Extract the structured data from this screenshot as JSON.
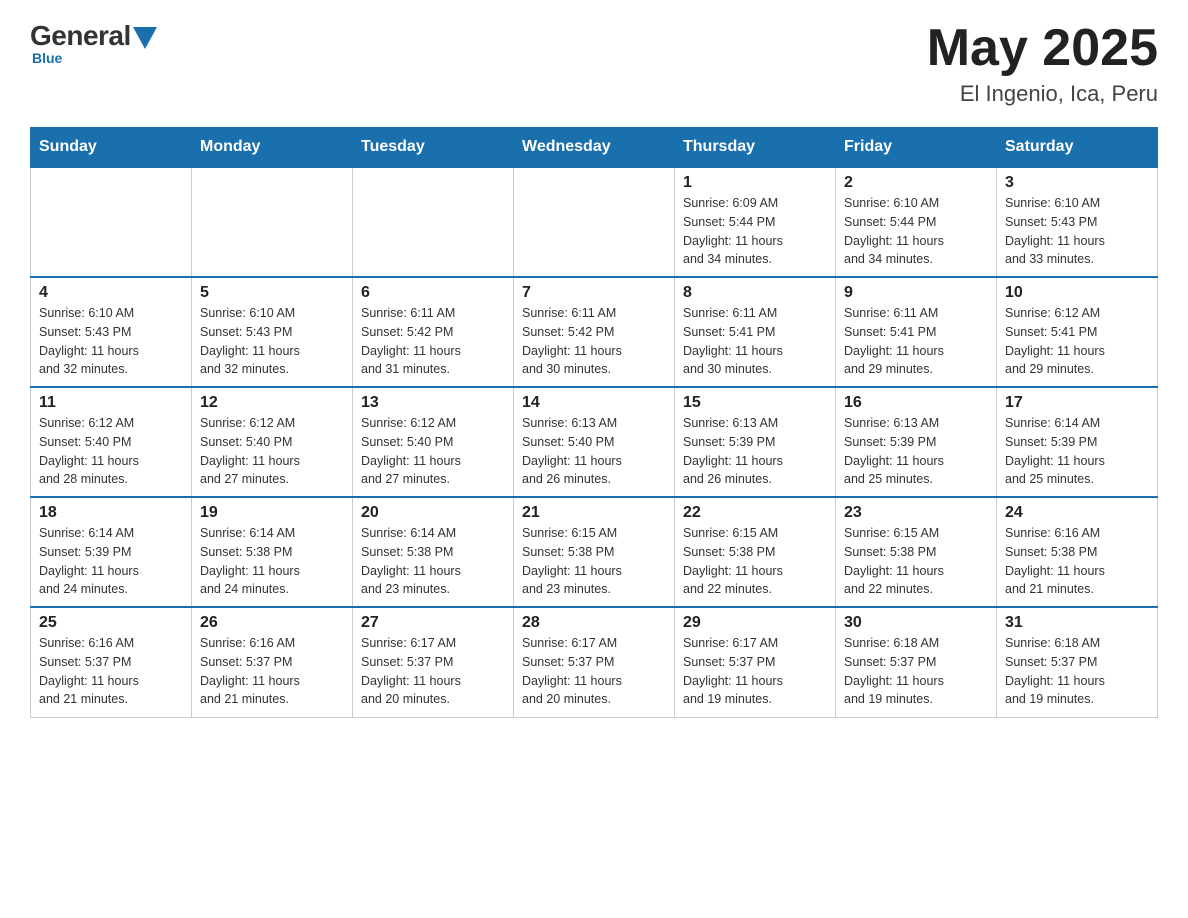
{
  "header": {
    "logo": {
      "general": "General",
      "blue": "Blue",
      "tagline": "Blue"
    },
    "title": "May 2025",
    "location": "El Ingenio, Ica, Peru"
  },
  "calendar": {
    "days_of_week": [
      "Sunday",
      "Monday",
      "Tuesday",
      "Wednesday",
      "Thursday",
      "Friday",
      "Saturday"
    ],
    "weeks": [
      [
        {
          "day": "",
          "info": ""
        },
        {
          "day": "",
          "info": ""
        },
        {
          "day": "",
          "info": ""
        },
        {
          "day": "",
          "info": ""
        },
        {
          "day": "1",
          "info": "Sunrise: 6:09 AM\nSunset: 5:44 PM\nDaylight: 11 hours\nand 34 minutes."
        },
        {
          "day": "2",
          "info": "Sunrise: 6:10 AM\nSunset: 5:44 PM\nDaylight: 11 hours\nand 34 minutes."
        },
        {
          "day": "3",
          "info": "Sunrise: 6:10 AM\nSunset: 5:43 PM\nDaylight: 11 hours\nand 33 minutes."
        }
      ],
      [
        {
          "day": "4",
          "info": "Sunrise: 6:10 AM\nSunset: 5:43 PM\nDaylight: 11 hours\nand 32 minutes."
        },
        {
          "day": "5",
          "info": "Sunrise: 6:10 AM\nSunset: 5:43 PM\nDaylight: 11 hours\nand 32 minutes."
        },
        {
          "day": "6",
          "info": "Sunrise: 6:11 AM\nSunset: 5:42 PM\nDaylight: 11 hours\nand 31 minutes."
        },
        {
          "day": "7",
          "info": "Sunrise: 6:11 AM\nSunset: 5:42 PM\nDaylight: 11 hours\nand 30 minutes."
        },
        {
          "day": "8",
          "info": "Sunrise: 6:11 AM\nSunset: 5:41 PM\nDaylight: 11 hours\nand 30 minutes."
        },
        {
          "day": "9",
          "info": "Sunrise: 6:11 AM\nSunset: 5:41 PM\nDaylight: 11 hours\nand 29 minutes."
        },
        {
          "day": "10",
          "info": "Sunrise: 6:12 AM\nSunset: 5:41 PM\nDaylight: 11 hours\nand 29 minutes."
        }
      ],
      [
        {
          "day": "11",
          "info": "Sunrise: 6:12 AM\nSunset: 5:40 PM\nDaylight: 11 hours\nand 28 minutes."
        },
        {
          "day": "12",
          "info": "Sunrise: 6:12 AM\nSunset: 5:40 PM\nDaylight: 11 hours\nand 27 minutes."
        },
        {
          "day": "13",
          "info": "Sunrise: 6:12 AM\nSunset: 5:40 PM\nDaylight: 11 hours\nand 27 minutes."
        },
        {
          "day": "14",
          "info": "Sunrise: 6:13 AM\nSunset: 5:40 PM\nDaylight: 11 hours\nand 26 minutes."
        },
        {
          "day": "15",
          "info": "Sunrise: 6:13 AM\nSunset: 5:39 PM\nDaylight: 11 hours\nand 26 minutes."
        },
        {
          "day": "16",
          "info": "Sunrise: 6:13 AM\nSunset: 5:39 PM\nDaylight: 11 hours\nand 25 minutes."
        },
        {
          "day": "17",
          "info": "Sunrise: 6:14 AM\nSunset: 5:39 PM\nDaylight: 11 hours\nand 25 minutes."
        }
      ],
      [
        {
          "day": "18",
          "info": "Sunrise: 6:14 AM\nSunset: 5:39 PM\nDaylight: 11 hours\nand 24 minutes."
        },
        {
          "day": "19",
          "info": "Sunrise: 6:14 AM\nSunset: 5:38 PM\nDaylight: 11 hours\nand 24 minutes."
        },
        {
          "day": "20",
          "info": "Sunrise: 6:14 AM\nSunset: 5:38 PM\nDaylight: 11 hours\nand 23 minutes."
        },
        {
          "day": "21",
          "info": "Sunrise: 6:15 AM\nSunset: 5:38 PM\nDaylight: 11 hours\nand 23 minutes."
        },
        {
          "day": "22",
          "info": "Sunrise: 6:15 AM\nSunset: 5:38 PM\nDaylight: 11 hours\nand 22 minutes."
        },
        {
          "day": "23",
          "info": "Sunrise: 6:15 AM\nSunset: 5:38 PM\nDaylight: 11 hours\nand 22 minutes."
        },
        {
          "day": "24",
          "info": "Sunrise: 6:16 AM\nSunset: 5:38 PM\nDaylight: 11 hours\nand 21 minutes."
        }
      ],
      [
        {
          "day": "25",
          "info": "Sunrise: 6:16 AM\nSunset: 5:37 PM\nDaylight: 11 hours\nand 21 minutes."
        },
        {
          "day": "26",
          "info": "Sunrise: 6:16 AM\nSunset: 5:37 PM\nDaylight: 11 hours\nand 21 minutes."
        },
        {
          "day": "27",
          "info": "Sunrise: 6:17 AM\nSunset: 5:37 PM\nDaylight: 11 hours\nand 20 minutes."
        },
        {
          "day": "28",
          "info": "Sunrise: 6:17 AM\nSunset: 5:37 PM\nDaylight: 11 hours\nand 20 minutes."
        },
        {
          "day": "29",
          "info": "Sunrise: 6:17 AM\nSunset: 5:37 PM\nDaylight: 11 hours\nand 19 minutes."
        },
        {
          "day": "30",
          "info": "Sunrise: 6:18 AM\nSunset: 5:37 PM\nDaylight: 11 hours\nand 19 minutes."
        },
        {
          "day": "31",
          "info": "Sunrise: 6:18 AM\nSunset: 5:37 PM\nDaylight: 11 hours\nand 19 minutes."
        }
      ]
    ]
  }
}
